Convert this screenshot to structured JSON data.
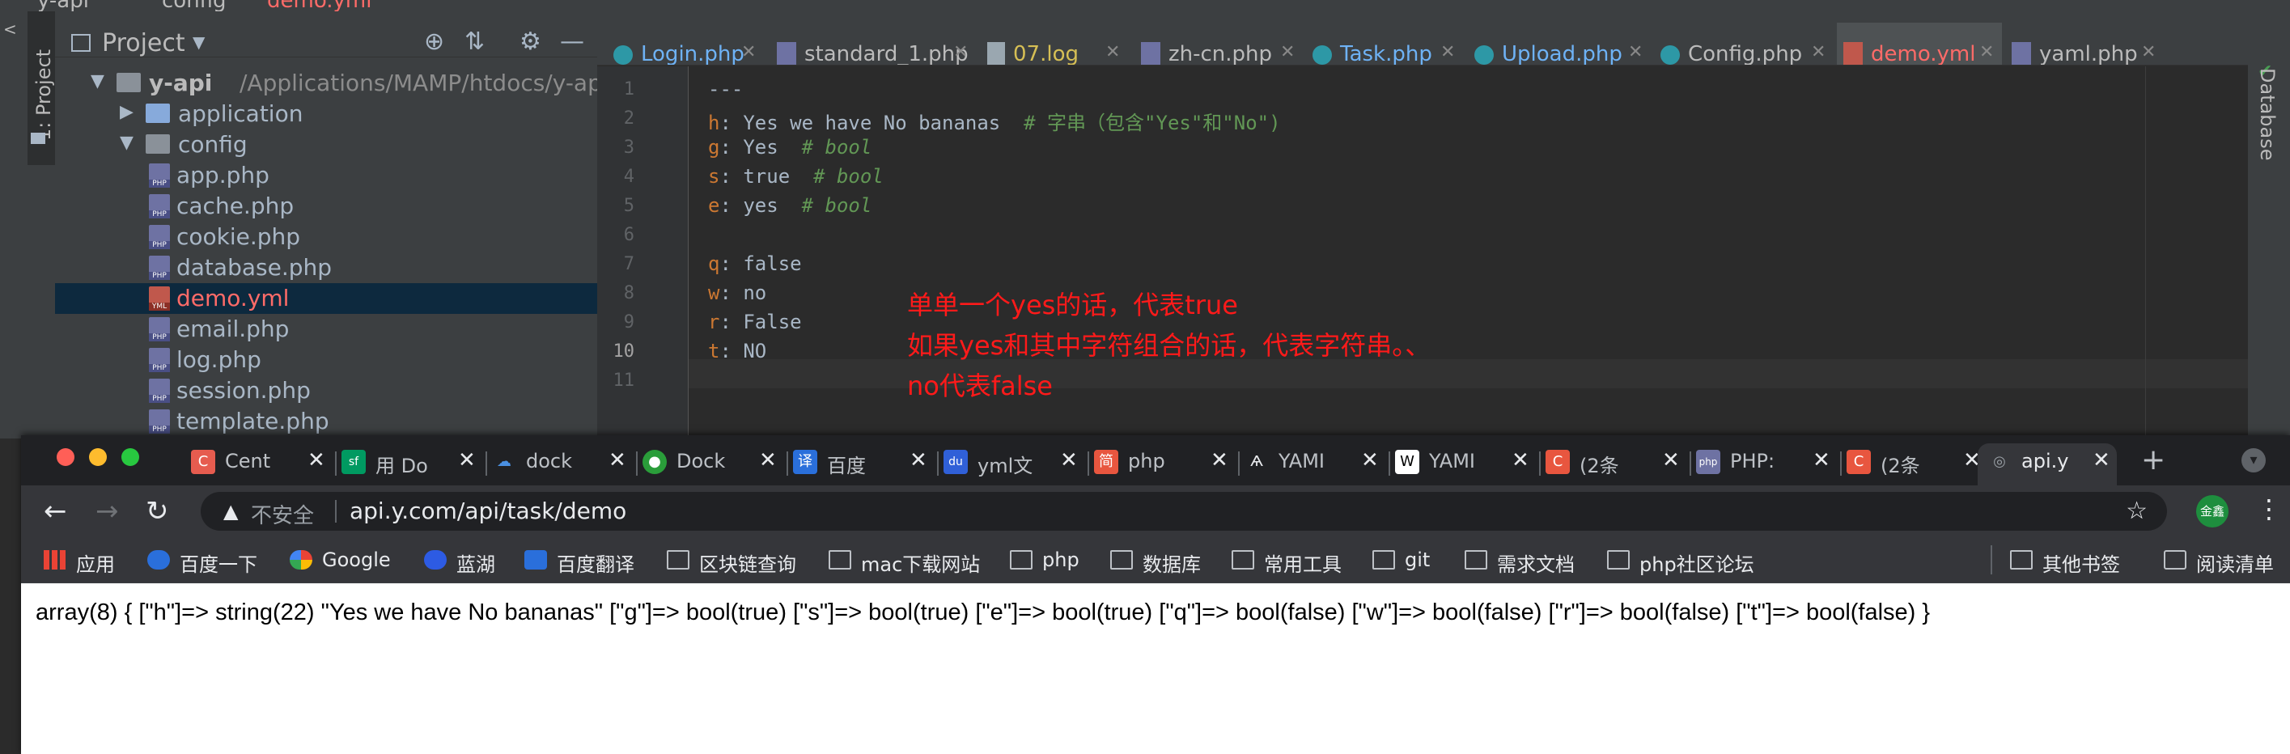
{
  "ide": {
    "breadcrumb": [
      "y-api",
      "config",
      "demo.yml"
    ],
    "tool_window_label": "1: Project",
    "right_tool_label": "Database",
    "project_panel": {
      "title": "Project",
      "root_name": "y-api",
      "root_path": "/Applications/MAMP/htdocs/y-api",
      "tree": [
        {
          "label": "application",
          "type": "folder",
          "expanded": false
        },
        {
          "label": "config",
          "type": "folder",
          "expanded": true
        },
        {
          "label": "app.php",
          "type": "php"
        },
        {
          "label": "cache.php",
          "type": "php"
        },
        {
          "label": "cookie.php",
          "type": "php"
        },
        {
          "label": "database.php",
          "type": "php"
        },
        {
          "label": "demo.yml",
          "type": "yml",
          "selected": true
        },
        {
          "label": "email.php",
          "type": "php"
        },
        {
          "label": "log.php",
          "type": "php"
        },
        {
          "label": "session.php",
          "type": "php"
        },
        {
          "label": "template.php",
          "type": "php"
        }
      ]
    },
    "editor_tabs": [
      {
        "label": "Login.php",
        "icon": "class-icon"
      },
      {
        "label": "standard_1.php",
        "icon": "php-file-icon"
      },
      {
        "label": "07.log",
        "icon": "log-file-icon"
      },
      {
        "label": "zh-cn.php",
        "icon": "php-file-icon"
      },
      {
        "label": "Task.php",
        "icon": "class-icon"
      },
      {
        "label": "Upload.php",
        "icon": "class-icon"
      },
      {
        "label": "Config.php",
        "icon": "class-icon"
      },
      {
        "label": "demo.yml",
        "icon": "yml-file-icon",
        "active": true
      },
      {
        "label": "yaml.php",
        "icon": "php-file-icon"
      }
    ],
    "line_numbers": [
      "1",
      "2",
      "3",
      "4",
      "5",
      "6",
      "7",
      "8",
      "9",
      "10",
      "11"
    ],
    "code_lines": [
      {
        "key": "",
        "value": "---",
        "comment": ""
      },
      {
        "key": "h",
        "value": "Yes we have No bananas",
        "comment": "# 字串（包含\"Yes\"和\"No\")"
      },
      {
        "key": "g",
        "value": "Yes",
        "comment": "# bool"
      },
      {
        "key": "s",
        "value": "true",
        "comment": "# bool"
      },
      {
        "key": "e",
        "value": "yes",
        "comment": "# bool"
      },
      {
        "key": "",
        "value": "",
        "comment": ""
      },
      {
        "key": "q",
        "value": "false",
        "comment": ""
      },
      {
        "key": "w",
        "value": "no",
        "comment": ""
      },
      {
        "key": "r",
        "value": "False",
        "comment": ""
      },
      {
        "key": "t",
        "value": "NO",
        "comment": ""
      },
      {
        "key": "",
        "value": "",
        "comment": ""
      }
    ],
    "annotations": [
      "单单一个yes的话，代表true",
      "如果yes和其中字符组合的话，代表字符串。、",
      "no代表false"
    ]
  },
  "browser": {
    "tabs": [
      {
        "label": "Cent",
        "fav_color": "#e65c4f",
        "fav_char": "C"
      },
      {
        "label": "用 Do",
        "fav_color": "#009a61",
        "fav_char": "sf"
      },
      {
        "label": "dock",
        "fav_color": "#4a90e2",
        "fav_char": "☁"
      },
      {
        "label": "Dock",
        "fav_color": "#2a9d3a",
        "fav_char": "●"
      },
      {
        "label": "百度",
        "fav_color": "#2a6fdb",
        "fav_char": "译"
      },
      {
        "label": "yml文",
        "fav_color": "#3060d8",
        "fav_char": "du"
      },
      {
        "label": "php",
        "fav_color": "#e8563f",
        "fav_char": "简"
      },
      {
        "label": "YAMI",
        "fav_color": "#444444",
        "fav_char": "Ѧ"
      },
      {
        "label": "YAMI",
        "fav_color": "#ffffff",
        "fav_char": "W"
      },
      {
        "label": "(2条",
        "fav_color": "#e8563f",
        "fav_char": "C"
      },
      {
        "label": "PHP:",
        "fav_color": "#6e72a3",
        "fav_char": "php"
      },
      {
        "label": "(2条",
        "fav_color": "#e8563f",
        "fav_char": "C"
      },
      {
        "label": "api.y",
        "fav_color": "#5f6368",
        "fav_char": "◎",
        "active": true
      }
    ],
    "address": {
      "security_label": "不安全",
      "url": "api.y.com/api/task/demo"
    },
    "avatar_text": "金鑫",
    "bookmarks": [
      {
        "label": "应用",
        "icon": "apps-grid-icon"
      },
      {
        "label": "百度一下",
        "icon": "baidu-icon"
      },
      {
        "label": "Google",
        "icon": "google-icon"
      },
      {
        "label": "蓝湖",
        "icon": "lanhu-icon"
      },
      {
        "label": "百度翻译",
        "icon": "translate-icon"
      },
      {
        "label": "区块链查询",
        "icon": "folder-icon"
      },
      {
        "label": "mac下载网站",
        "icon": "folder-icon"
      },
      {
        "label": "php",
        "icon": "folder-icon"
      },
      {
        "label": "数据库",
        "icon": "folder-icon"
      },
      {
        "label": "常用工具",
        "icon": "folder-icon"
      },
      {
        "label": "git",
        "icon": "folder-icon"
      },
      {
        "label": "需求文档",
        "icon": "folder-icon"
      },
      {
        "label": "php社区论坛",
        "icon": "folder-icon"
      }
    ],
    "bookmarks_right": [
      {
        "label": "其他书签",
        "icon": "folder-icon"
      },
      {
        "label": "阅读清单",
        "icon": "reading-list-icon"
      }
    ],
    "page_output": "array(8) { [\"h\"]=> string(22) \"Yes we have No bananas\" [\"g\"]=> bool(true) [\"s\"]=> bool(true) [\"e\"]=> bool(true) [\"q\"]=> bool(false) [\"w\"]=> bool(false) [\"r\"]=> bool(false) [\"t\"]=> bool(false) }"
  }
}
